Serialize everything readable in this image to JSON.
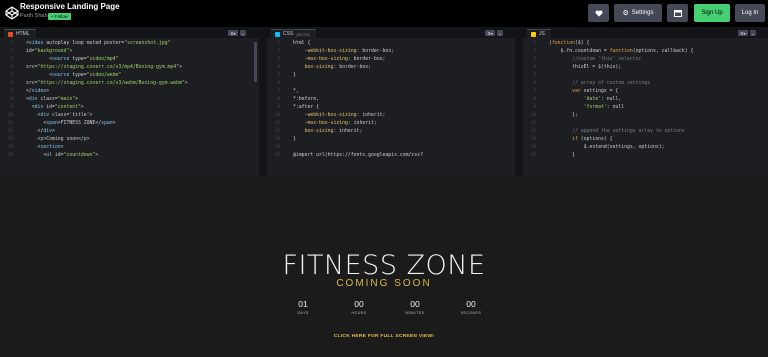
{
  "header": {
    "title": "Responsive Landing Page",
    "author": "Parth Shah",
    "follow_label": "+ Follow",
    "buttons": {
      "like_icon": "heart-icon",
      "settings_label": "Settings",
      "layout_icon": "layout-icon",
      "signup_label": "Sign Up",
      "login_label": "Log In"
    },
    "colors": {
      "signup_bg": "#47cf73",
      "button_bg": "#444857"
    }
  },
  "editors": {
    "html": {
      "tab_label": "HTML",
      "icon_color": "#e34c26",
      "lines": [
        {
          "n": "",
          "t": "<video autoplay loop muted poster=\"screenshot.jpg\""
        },
        {
          "n": "",
          "t": "id=\"background\">"
        },
        {
          "n": "",
          "t": "        <source type=\"video/mp4\""
        },
        {
          "n": "",
          "t": "src=\"https://staging.coverr.co/s3/mp4/Boxing-gym.mp4\">"
        },
        {
          "n": "",
          "t": "        <source type=\"video/webm\""
        },
        {
          "n": "",
          "t": "src=\"https://staging.coverr.co/s3/webm/Boxing-gym.webm\">"
        },
        {
          "n": "",
          "t": "</video>"
        },
        {
          "n": "",
          "t": "<div class=\"main\">"
        },
        {
          "n": "",
          "t": "  <div id=\"content\">"
        },
        {
          "n": "",
          "t": "    <div class='title'>"
        },
        {
          "n": "",
          "t": "      <span>FITNESS ZONE</span>"
        },
        {
          "n": "",
          "t": "    </div>"
        },
        {
          "n": "",
          "t": "    <p>Coming soon</p>"
        },
        {
          "n": "",
          "t": "    <section>"
        },
        {
          "n": "",
          "t": "      <ul id=\"countdown\">"
        }
      ]
    },
    "css": {
      "tab_label": "CSS",
      "tab_sub": "(SCSS)",
      "icon_color": "#0ebeff",
      "lines": [
        {
          "n": "",
          "t": "html {"
        },
        {
          "n": "",
          "t": "    -webkit-box-sizing: border-box;"
        },
        {
          "n": "",
          "t": "    -moz-box-sizing: border-box;"
        },
        {
          "n": "",
          "t": "    box-sizing: border-box;"
        },
        {
          "n": "",
          "t": "}"
        },
        {
          "n": "",
          "t": ""
        },
        {
          "n": "",
          "t": "*,"
        },
        {
          "n": "",
          "t": "*:before,"
        },
        {
          "n": "",
          "t": "*:after {"
        },
        {
          "n": "",
          "t": "    -webkit-box-sizing: inherit;"
        },
        {
          "n": "",
          "t": "    -moz-box-sizing: inherit;"
        },
        {
          "n": "",
          "t": "    box-sizing: inherit;"
        },
        {
          "n": "",
          "t": "}"
        },
        {
          "n": "",
          "t": ""
        },
        {
          "n": "",
          "t": "@import url(https://fonts.googleapis.com/css?"
        }
      ]
    },
    "js": {
      "tab_label": "JS",
      "icon_color": "#fcd000",
      "lines": [
        {
          "n": "",
          "t": "(function($) {"
        },
        {
          "n": "",
          "t": "    $.fn.countdown = function(options, callback) {"
        },
        {
          "n": "",
          "t": "        //custom 'this' selector"
        },
        {
          "n": "",
          "t": "        thisEl = $(this);"
        },
        {
          "n": "",
          "t": ""
        },
        {
          "n": "",
          "t": "        // array of custom settings"
        },
        {
          "n": "",
          "t": "        var settings = {"
        },
        {
          "n": "",
          "t": "            'date': null,"
        },
        {
          "n": "",
          "t": "            'format': null"
        },
        {
          "n": "",
          "t": "        };"
        },
        {
          "n": "",
          "t": ""
        },
        {
          "n": "",
          "t": "        // append the settings array to options"
        },
        {
          "n": "",
          "t": "        if (options) {"
        },
        {
          "n": "",
          "t": "            $.extend(settings, options);"
        },
        {
          "n": "",
          "t": "        }"
        }
      ]
    }
  },
  "preview": {
    "heading": "FITNESS ZONE",
    "subheading": "COMING SOON",
    "countdown": [
      {
        "value": "01",
        "label": "DAYS"
      },
      {
        "value": "00",
        "label": "HOURS"
      },
      {
        "value": "00",
        "label": "MINUTES"
      },
      {
        "value": "00",
        "label": "SECONDS"
      }
    ],
    "fullscreen_link": "CLICK HERE FOR FULL SCREEN VIEW!",
    "colors": {
      "accent": "#d9b84a",
      "background": "#1b1b1b"
    }
  }
}
